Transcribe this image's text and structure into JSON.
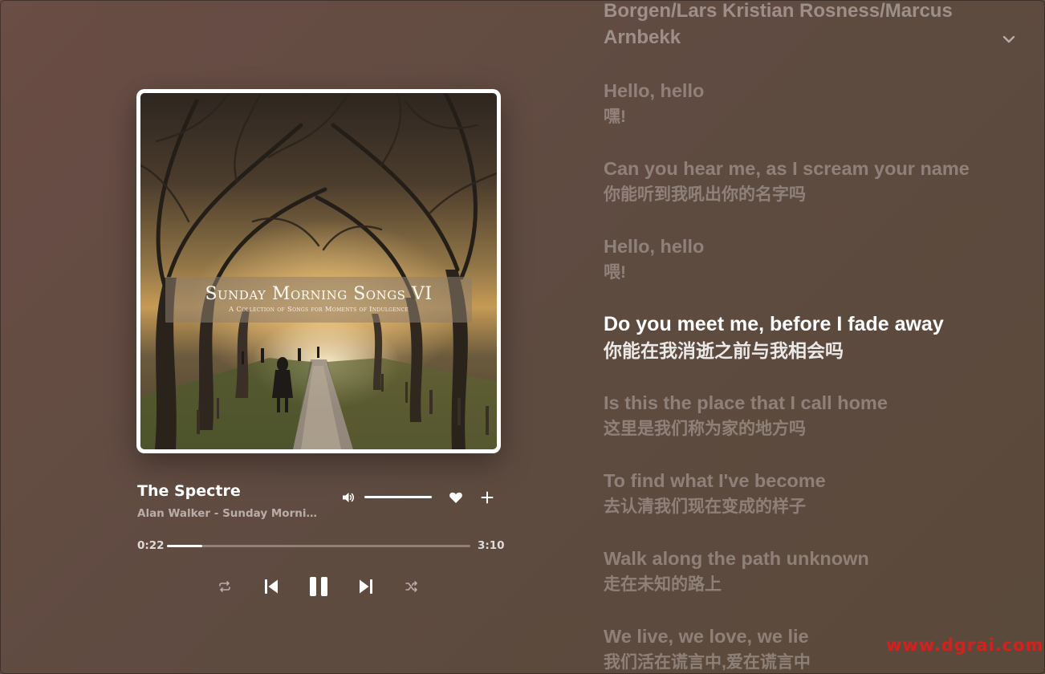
{
  "album": {
    "cover_title": "Sunday Morning Songs VI",
    "cover_subtitle": "A Collection of Songs for Moments of Indulgence"
  },
  "track": {
    "title": "The Spectre",
    "artist_album": "Alan Walker - Sunday Morning..."
  },
  "playback": {
    "current_time": "0:22",
    "duration": "3:10",
    "progress_fraction": 0.116,
    "volume_fraction": 1.0,
    "state": "playing"
  },
  "icons": {
    "volume": "volume-icon",
    "like": "heart-icon",
    "add": "plus-icon",
    "repeat": "repeat-icon",
    "previous": "skip-previous-icon",
    "pause": "pause-icon",
    "next": "skip-next-icon",
    "shuffle": "shuffle-icon",
    "collapse": "chevron-down-icon"
  },
  "lyrics": {
    "credit": "Borgen/Lars Kristian Rosness/Marcus Arnbekk",
    "lines": [
      {
        "orig": "Hello, hello",
        "trans": "嘿!"
      },
      {
        "orig": "Can you hear me, as I scream your name",
        "trans": "你能听到我吼出你的名字吗"
      },
      {
        "orig": "Hello, hello",
        "trans": "喂!"
      },
      {
        "orig": "Do you meet me, before I fade away",
        "trans": "你能在我消逝之前与我相会吗"
      },
      {
        "orig": "Is this the place that I call home",
        "trans": "这里是我们称为家的地方吗"
      },
      {
        "orig": "To find what I've become",
        "trans": "去认清我们现在变成的样子"
      },
      {
        "orig": "Walk along the path unknown",
        "trans": "走在未知的路上"
      },
      {
        "orig": "We live, we love, we lie",
        "trans": "我们活在谎言中,爱在谎言中"
      }
    ],
    "active_index": 3
  },
  "watermark": "www.dgrai.com",
  "colors": {
    "background": "#61493f",
    "active_text": "#ffffff",
    "watermark": "#d3211e"
  }
}
